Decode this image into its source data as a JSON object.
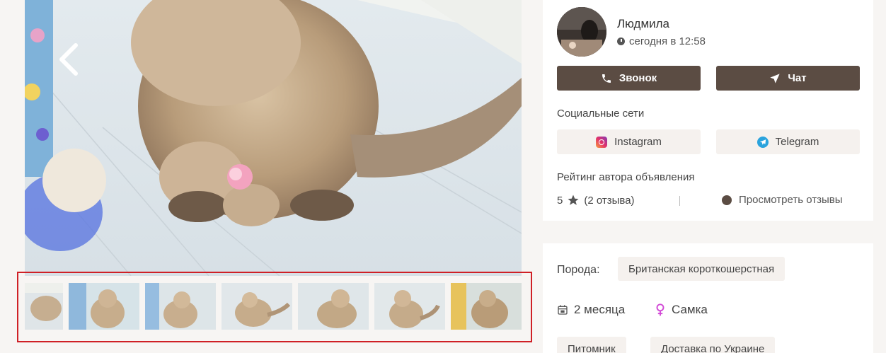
{
  "gallery": {
    "thumbnails": [
      "thumb-1",
      "thumb-2",
      "thumb-3",
      "thumb-4",
      "thumb-5",
      "thumb-6",
      "thumb-7"
    ]
  },
  "seller": {
    "name": "Людмила",
    "time": "сегодня в 12:58"
  },
  "actions": {
    "call_label": "Звонок",
    "chat_label": "Чат"
  },
  "social": {
    "title": "Социальные сети",
    "instagram_label": "Instagram",
    "telegram_label": "Telegram"
  },
  "rating": {
    "title": "Рейтинг автора объявления",
    "score": "5",
    "reviews_count": "(2 отзыва)",
    "view_reviews_label": "Просмотреть отзывы"
  },
  "details": {
    "breed_label": "Порода:",
    "breed_value": "Британская короткошерстная",
    "age": "2 месяца",
    "gender": "Самка",
    "tags": [
      "Питомник",
      "Доставка по Украине"
    ]
  },
  "colors": {
    "accent": "#5b4c43",
    "highlight_border": "#cf2026",
    "female_icon": "#d24bd6"
  }
}
